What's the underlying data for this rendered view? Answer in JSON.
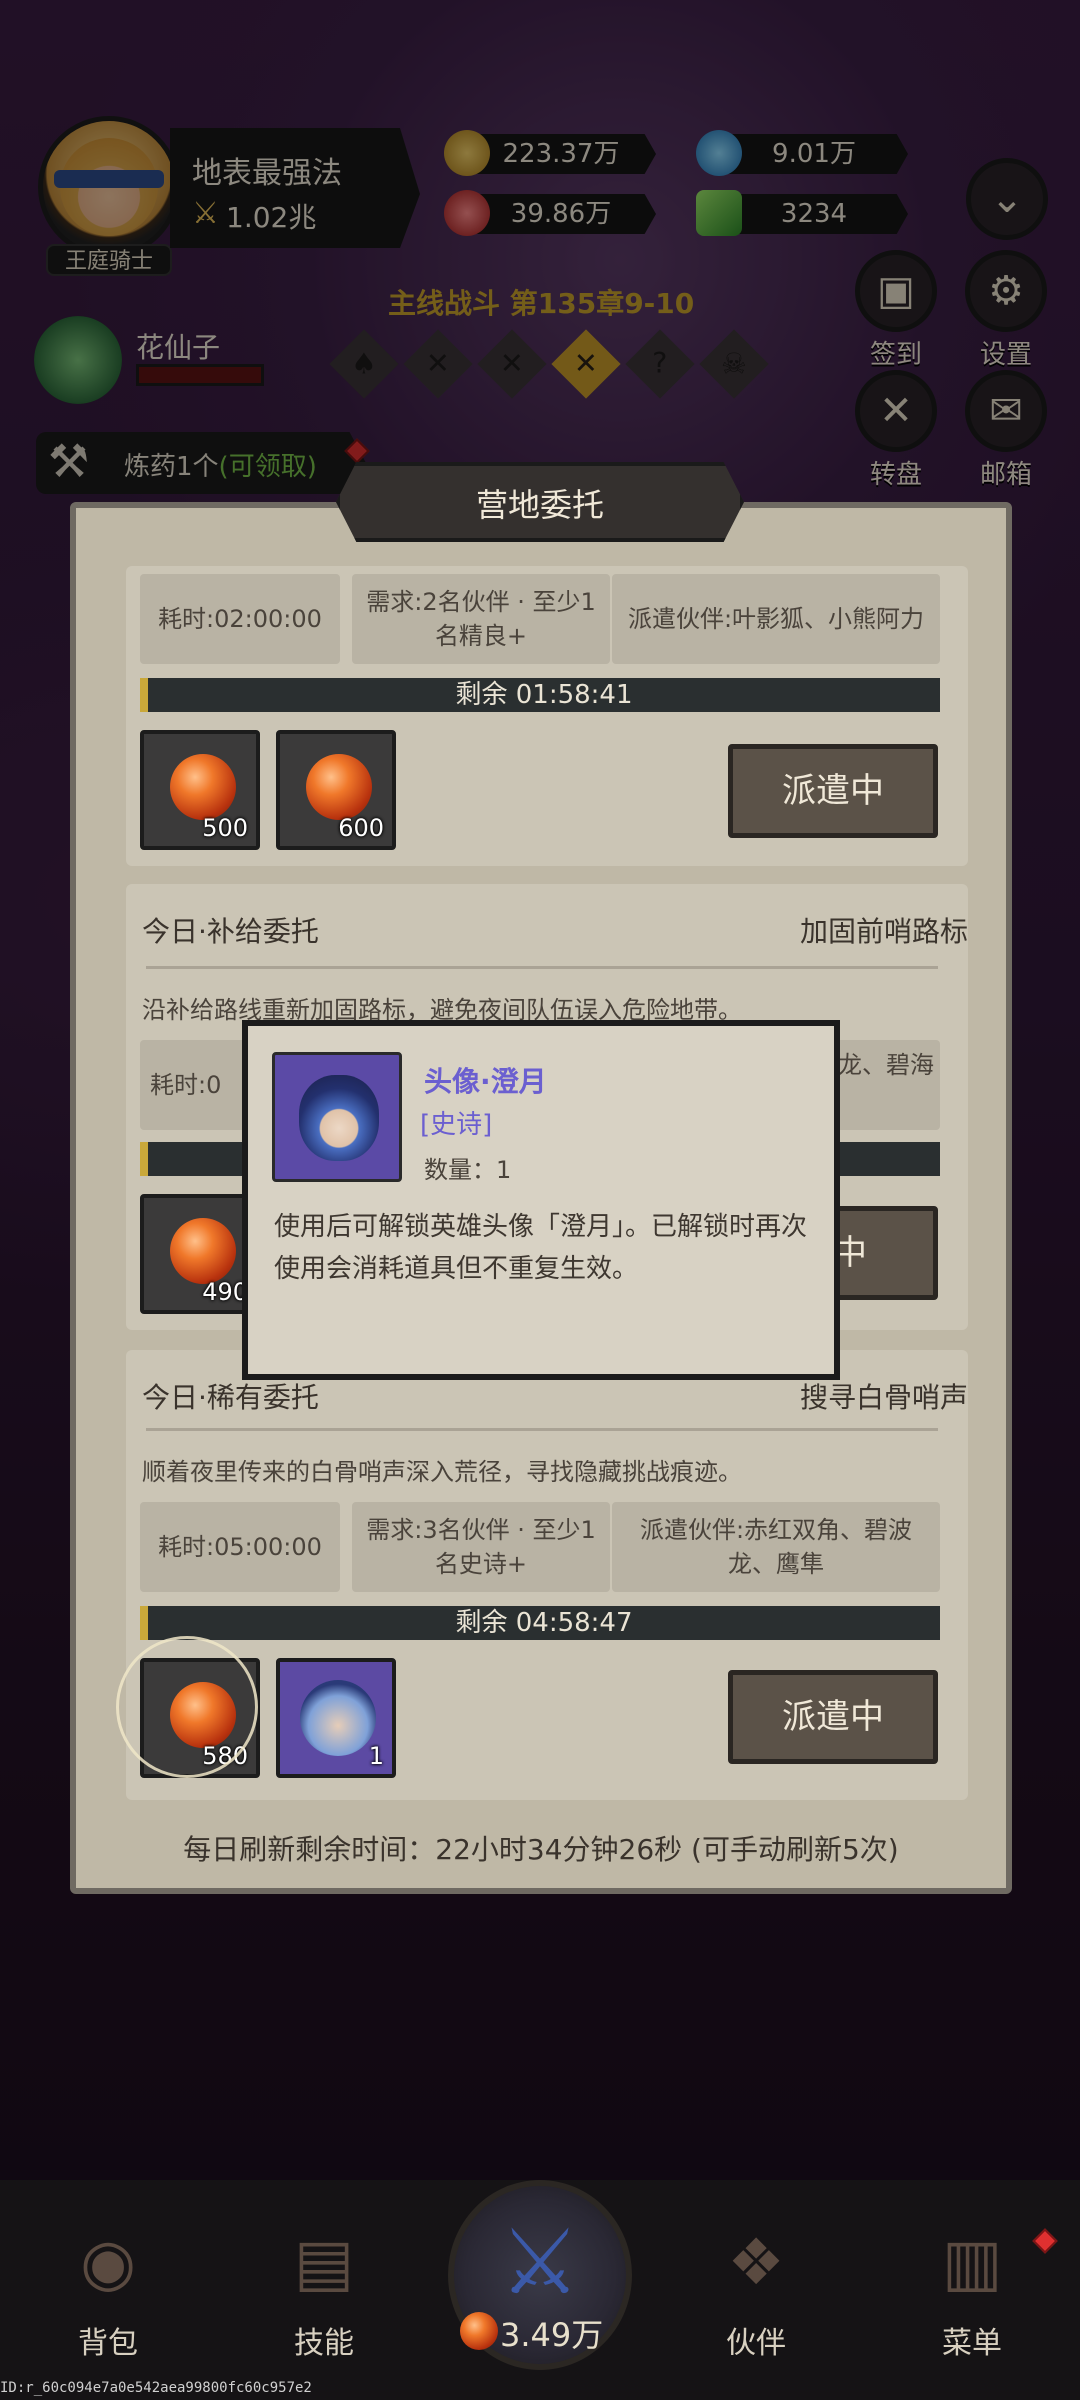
{
  "player": {
    "name": "地表最强法",
    "power": "1.02兆",
    "title": "王庭骑士"
  },
  "resources": [
    {
      "name": "gold",
      "value": "223.37万",
      "color": "#c99a2a"
    },
    {
      "name": "diamond-blue",
      "value": "9.01万",
      "color": "#3a8fd0"
    },
    {
      "name": "ruby",
      "value": "39.86万",
      "color": "#d03a3a"
    },
    {
      "name": "emerald",
      "value": "3234",
      "color": "#3ab04a"
    }
  ],
  "side_menu": [
    {
      "label": "签到"
    },
    {
      "label": "设置"
    },
    {
      "label": "转盘"
    },
    {
      "label": "邮箱"
    }
  ],
  "chapter": {
    "text": "主线战斗 第135章9-10"
  },
  "companion": {
    "name": "花仙子"
  },
  "alchemy": {
    "text": "炼药1个",
    "claim": "(可领取)"
  },
  "modal": {
    "title": "营地委托",
    "missions": [
      {
        "duration": "耗时:02:00:00",
        "requirement": "需求:2名伙伴 · 至少1名精良+",
        "dispatched": "派遣伙伴:叶影狐、小熊阿力",
        "remaining": "剩余 01:58:41",
        "rewards": [
          {
            "qty": "500"
          },
          {
            "qty": "600"
          }
        ],
        "button": "派遣中"
      },
      {
        "head_left": "今日·补给委托",
        "head_right": "加固前哨路标",
        "description": "沿补给路线重新加固路标，避免夜间队伍误入危险地带。",
        "duration": "耗时:0",
        "dispatched": "龙、碧海",
        "rewards": [
          {
            "qty": "490"
          }
        ],
        "button": "遣中"
      },
      {
        "head_left": "今日·稀有委托",
        "head_right": "搜寻白骨哨声",
        "description": "顺着夜里传来的白骨哨声深入荒径，寻找隐藏挑战痕迹。",
        "duration": "耗时:05:00:00",
        "requirement": "需求:3名伙伴 · 至少1名史诗+",
        "dispatched": "派遣伙伴:赤红双角、碧波龙、鹰隼",
        "remaining": "剩余 04:58:47",
        "rewards": [
          {
            "qty": "580"
          },
          {
            "qty": "1"
          }
        ],
        "button": "派遣中"
      }
    ],
    "refresh_text": "每日刷新剩余时间：22小时34分钟26秒 (可手动刷新5次)"
  },
  "tooltip": {
    "name": "头像·澄月",
    "rarity": "[史诗]",
    "count": "数量：1",
    "description": "使用后可解锁英雄头像「澄月」。已解锁时再次使用会消耗道具但不重复生效。"
  },
  "bottom_nav": {
    "bag": "背包",
    "skills": "技能",
    "battle_value": "3.49万",
    "partners": "伙伴",
    "menu": "菜单"
  },
  "debug_id": "ID:r_60c094e7a0e542aea99800fc60c957e2"
}
